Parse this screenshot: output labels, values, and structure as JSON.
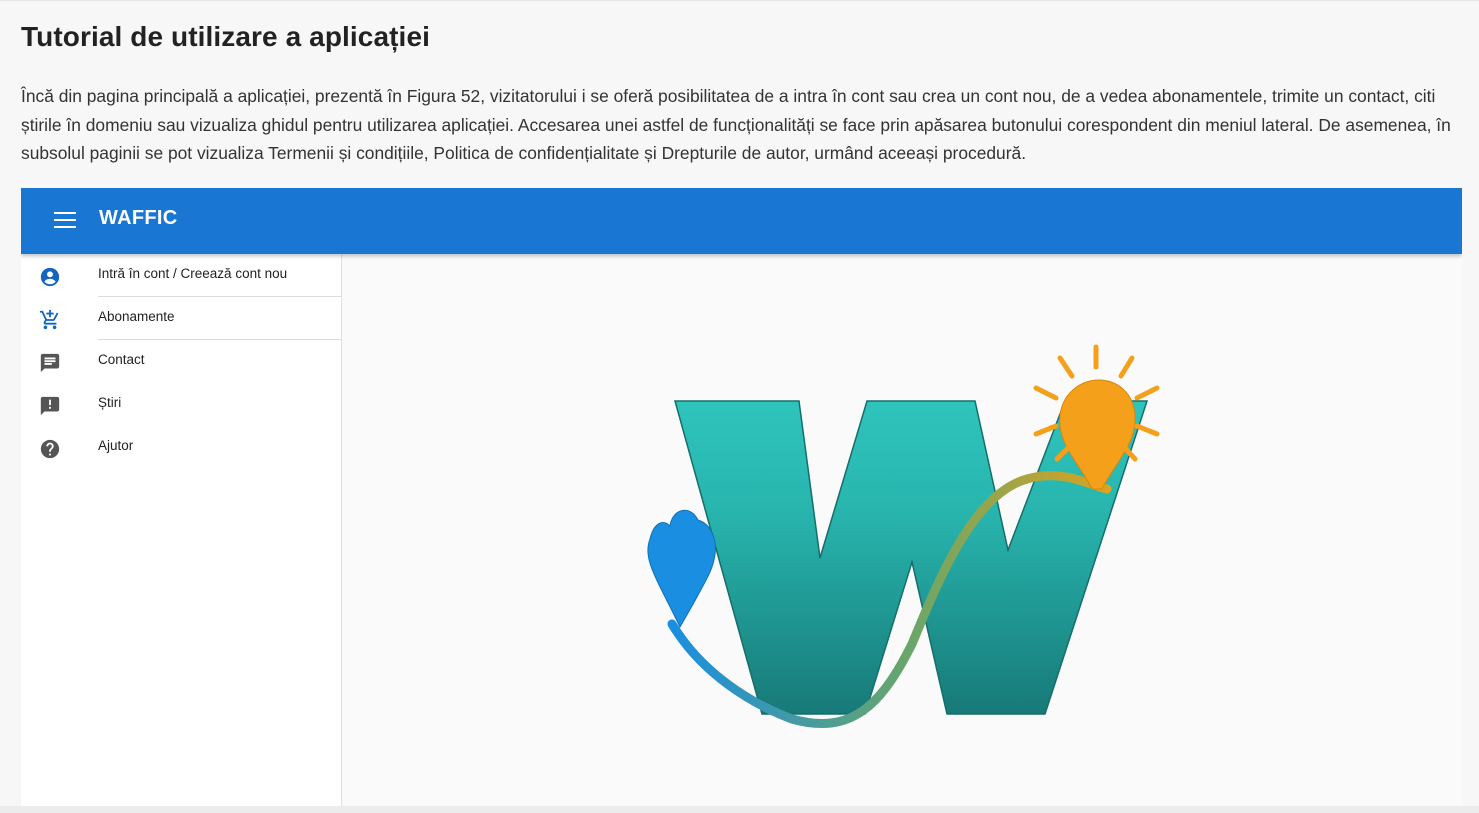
{
  "page": {
    "title": "Tutorial de utilizare a aplicației",
    "intro": "Încă din pagina principală a aplicației, prezentă în Figura 52, vizitatorului i se oferă posibilitatea de a intra în cont sau crea un cont nou, de a vedea abonamentele, trimite un contact, citi știrile în domeniu sau vizualiza ghidul pentru utilizarea aplicației. Accesarea unei astfel de funcționalități se face prin apăsarea butonului corespondent din meniul lateral. De asemenea, în subsolul paginii se pot vizualiza Termenii și condițiile, Politica de confidențialitate și Drepturile de autor, urmând aceeași procedură."
  },
  "app": {
    "title": "WAFFIC",
    "brand_color": "#1976d2",
    "menu_icon": "menu-icon"
  },
  "sidebar": {
    "items": [
      {
        "icon": "account-circle-icon",
        "label": "Intră în cont / Creează cont nou"
      },
      {
        "icon": "add-shopping-cart-icon",
        "label": "Abonamente"
      },
      {
        "icon": "chat-icon",
        "label": "Contact"
      },
      {
        "icon": "announcement-icon",
        "label": "Știri"
      },
      {
        "icon": "help-icon",
        "label": "Ajutor"
      }
    ]
  },
  "logo": {
    "icon": "waffic-logo",
    "colors": {
      "teal_top": "#2ec4bc",
      "teal_bottom": "#177a78",
      "sun": "#f5a01a",
      "drop": "#1a8ee0"
    }
  }
}
